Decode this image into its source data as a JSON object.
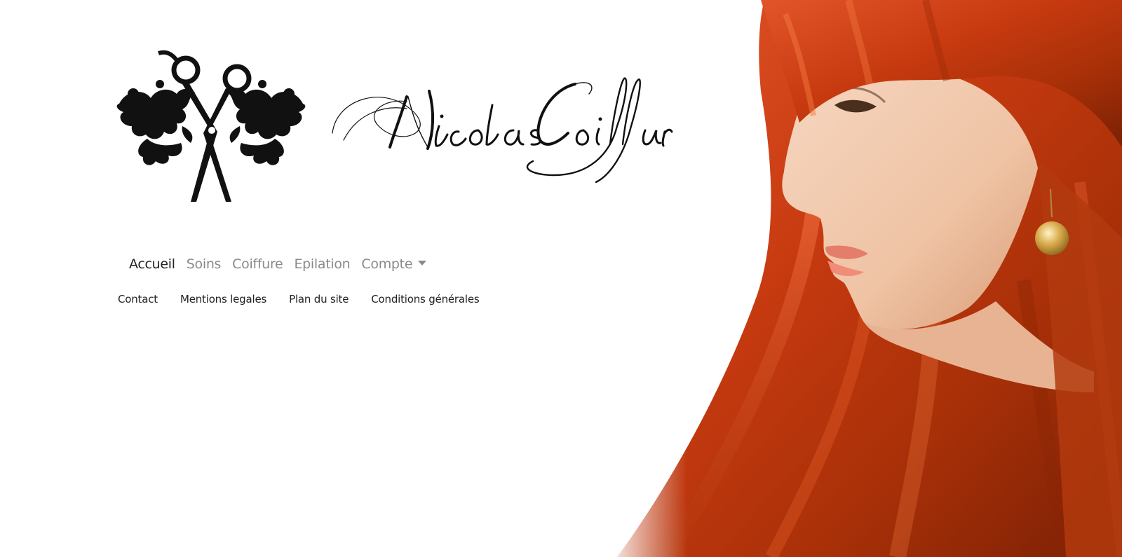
{
  "brand": {
    "name": "NicolasCoiffure",
    "logo_icon": "scissors-floral-icon"
  },
  "main_nav": {
    "items": [
      {
        "label": "Accueil",
        "active": true
      },
      {
        "label": "Soins",
        "active": false
      },
      {
        "label": "Coiffure",
        "active": false
      },
      {
        "label": "Epilation",
        "active": false
      },
      {
        "label": "Compte",
        "active": false,
        "dropdown": true
      }
    ]
  },
  "sub_nav": {
    "items": [
      {
        "label": "Contact"
      },
      {
        "label": "Mentions legales"
      },
      {
        "label": "Plan du site"
      },
      {
        "label": "Conditions générales"
      }
    ]
  },
  "colors": {
    "background": "#ffffff",
    "nav_active": "#222222",
    "nav_inactive": "#8a8a8a",
    "hair": "#c2410c"
  }
}
